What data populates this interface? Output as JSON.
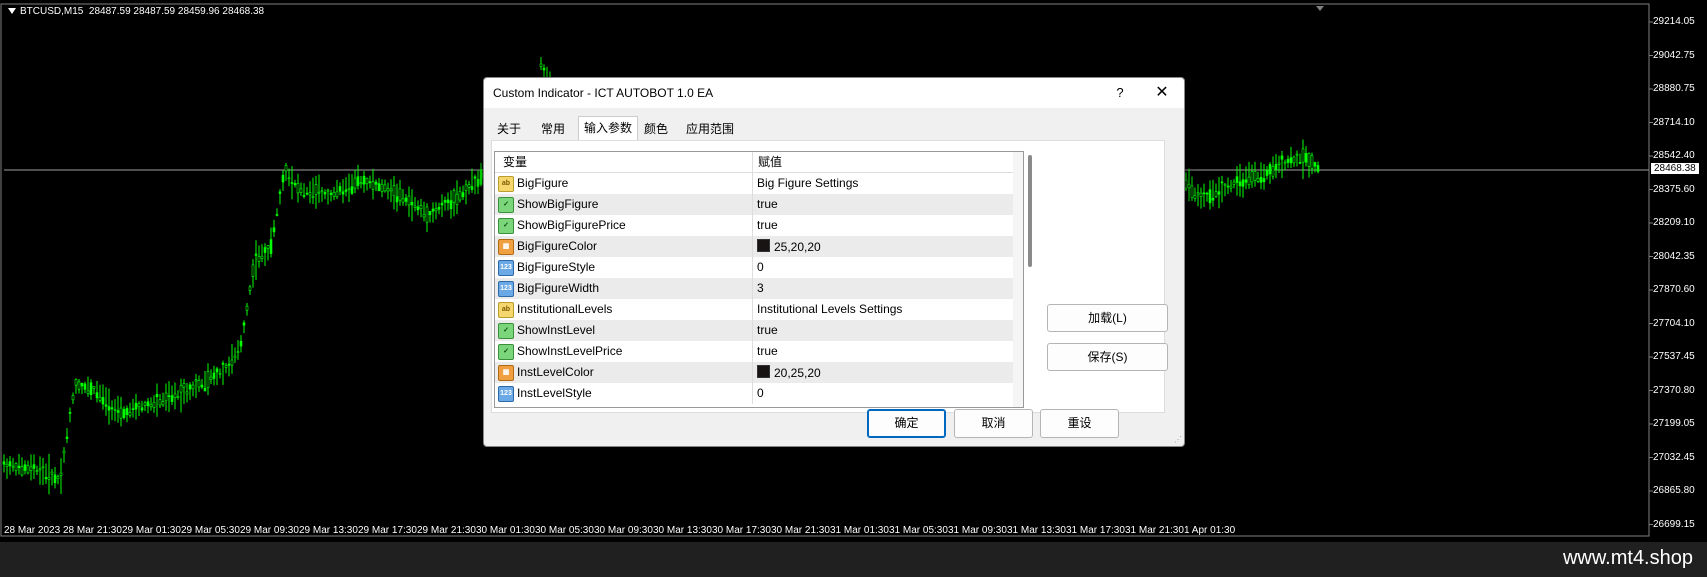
{
  "chart": {
    "symbol": "BTCUSD,M15",
    "ohlc": "28487.59 28487.59 28459.96 28468.38",
    "current_price": "28468.38",
    "price_axis": [
      "29214.05",
      "29042.75",
      "28880.75",
      "28714.10",
      "28542.40",
      "28375.60",
      "28209.10",
      "28042.35",
      "27870.60",
      "27704.10",
      "27537.45",
      "27370.80",
      "27199.05",
      "27032.45",
      "26865.80",
      "26699.15"
    ],
    "time_axis": [
      "28 Mar 2023",
      "28 Mar 21:30",
      "29 Mar 01:30",
      "29 Mar 05:30",
      "29 Mar 09:30",
      "29 Mar 13:30",
      "29 Mar 17:30",
      "29 Mar 21:30",
      "30 Mar 01:30",
      "30 Mar 05:30",
      "30 Mar 09:30",
      "30 Mar 13:30",
      "30 Mar 17:30",
      "30 Mar 21:30",
      "31 Mar 01:30",
      "31 Mar 05:30",
      "31 Mar 09:30",
      "31 Mar 13:30",
      "31 Mar 17:30",
      "31 Mar 21:30",
      "1 Apr 01:30"
    ],
    "candle_color": "#00ff00",
    "price_line_color": "#a0a0a0"
  },
  "dialog": {
    "title": "Custom Indicator - ICT AUTOBOT 1.0 EA",
    "help": "?",
    "close": "✕",
    "tabs": [
      "关于",
      "常用",
      "输入参数",
      "颜色",
      "应用范围"
    ],
    "active_tab": "输入参数",
    "grid": {
      "headers": {
        "variable": "变量",
        "value": "赋值"
      },
      "rows": [
        {
          "icon": "ab",
          "icon_name": "string-icon",
          "name": "BigFigure",
          "value": "Big Figure Settings"
        },
        {
          "icon": "bool",
          "icon_name": "bool-icon",
          "name": "ShowBigFigure",
          "value": "true"
        },
        {
          "icon": "bool",
          "icon_name": "bool-icon",
          "name": "ShowBigFigurePrice",
          "value": "true"
        },
        {
          "icon": "color",
          "icon_name": "color-icon",
          "name": "BigFigureColor",
          "value": "25,20,20",
          "swatch": true
        },
        {
          "icon": "num",
          "icon_name": "number-icon",
          "name": "BigFigureStyle",
          "value": "0"
        },
        {
          "icon": "num",
          "icon_name": "number-icon",
          "name": "BigFigureWidth",
          "value": "3"
        },
        {
          "icon": "ab",
          "icon_name": "string-icon",
          "name": "InstitutionalLevels",
          "value": "Institutional Levels Settings"
        },
        {
          "icon": "bool",
          "icon_name": "bool-icon",
          "name": "ShowInstLevel",
          "value": "true"
        },
        {
          "icon": "bool",
          "icon_name": "bool-icon",
          "name": "ShowInstLevelPrice",
          "value": "true"
        },
        {
          "icon": "color",
          "icon_name": "color-icon",
          "name": "InstLevelColor",
          "value": "20,25,20",
          "swatch": true
        },
        {
          "icon": "num",
          "icon_name": "number-icon",
          "name": "InstLevelStyle",
          "value": "0"
        }
      ]
    },
    "buttons": {
      "load": "加载(L)",
      "save": "保存(S)",
      "ok": "确定",
      "cancel": "取消",
      "reset": "重设"
    }
  },
  "footer": {
    "watermark": "www.mt4.shop"
  }
}
